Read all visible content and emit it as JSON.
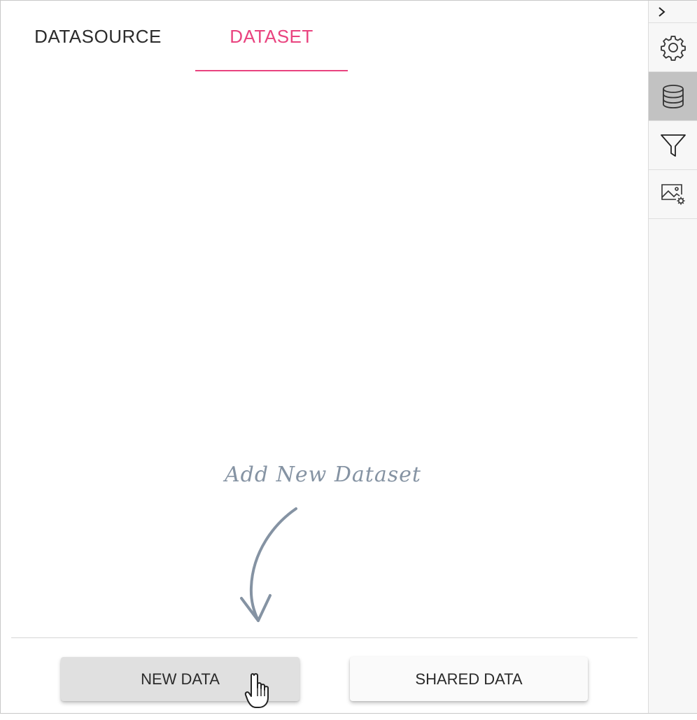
{
  "tabs": {
    "datasource_label": "DATASOURCE",
    "dataset_label": "DATASET",
    "active": "DATASET",
    "active_color": "#e9437f"
  },
  "empty_state": {
    "hint_text": "Add New Dataset"
  },
  "buttons": {
    "new_data_label": "NEW DATA",
    "shared_data_label": "SHARED DATA"
  },
  "side_rail": {
    "items": [
      {
        "icon": "chevron-right-icon"
      },
      {
        "icon": "gear-icon"
      },
      {
        "icon": "database-icon",
        "selected": true
      },
      {
        "icon": "filter-icon"
      },
      {
        "icon": "image-settings-icon"
      }
    ]
  }
}
